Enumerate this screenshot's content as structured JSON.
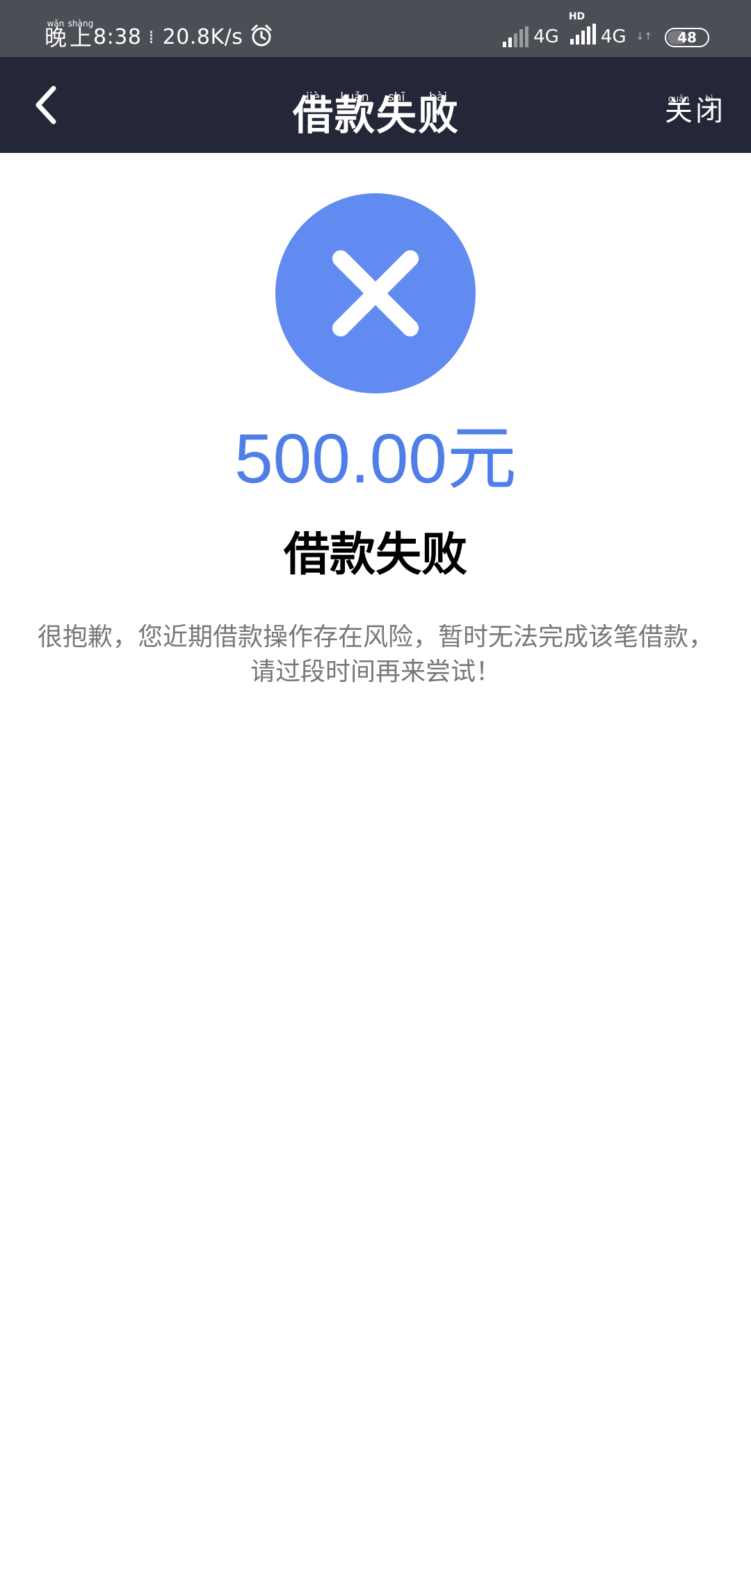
{
  "status_bar": {
    "time_label_chars": [
      {
        "char": "晚",
        "pinyin": "wǎn"
      },
      {
        "char": "上",
        "pinyin": "shàng"
      }
    ],
    "time": "8:38",
    "separator": "⁞",
    "network_speed": "20.8K/s",
    "icons": [
      "alarm-icon",
      "signal-icon",
      "signal-icon"
    ],
    "network_1": "4G",
    "hd_label": "HD",
    "network_2": "4G",
    "data_arrows": "↓↑",
    "battery": "48"
  },
  "nav": {
    "back_icon": "chevron-left-icon",
    "title_chars": [
      {
        "char": "借",
        "pinyin": "jiè"
      },
      {
        "char": "款",
        "pinyin": "kuǎn"
      },
      {
        "char": "失",
        "pinyin": "shī"
      },
      {
        "char": "败",
        "pinyin": "bài"
      }
    ],
    "close_chars": [
      {
        "char": "关",
        "pinyin": "guān"
      },
      {
        "char": "闭",
        "pinyin": "bì"
      }
    ]
  },
  "result": {
    "icon": "close-circle-icon",
    "icon_color": "#628bf2",
    "amount": "500.00元",
    "amount_color": "#4f7ee8",
    "title": "借款失败",
    "message_line1": "很抱歉，您近期借款操作存在风险，暂时无法完成该笔借款，",
    "message_line2": "请过段时间再来尝试！"
  },
  "colors": {
    "status_bar_bg": "#4c4e55",
    "nav_bg": "#232737",
    "page_bg": "#ffffff"
  }
}
